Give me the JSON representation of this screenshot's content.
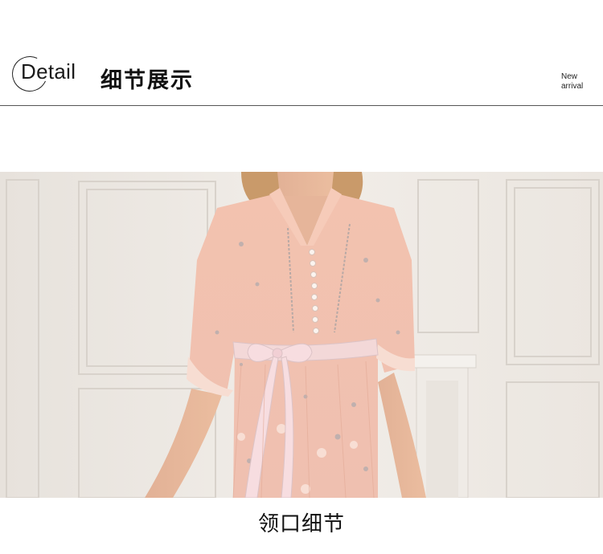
{
  "header": {
    "detail_word": "Detail",
    "title": "细节展示",
    "badge_line1": "New",
    "badge_line2": "arrival"
  },
  "photo": {
    "subject": "dress-collar-detail"
  },
  "caption": "领口细节",
  "colors": {
    "background": "#ffffff",
    "wall": "#ece8e3",
    "dress_pink": "#f2b9a6",
    "belt": "#f3d8d8",
    "skin": "#e8b89c",
    "hair": "#c99a6a",
    "text": "#111111"
  }
}
